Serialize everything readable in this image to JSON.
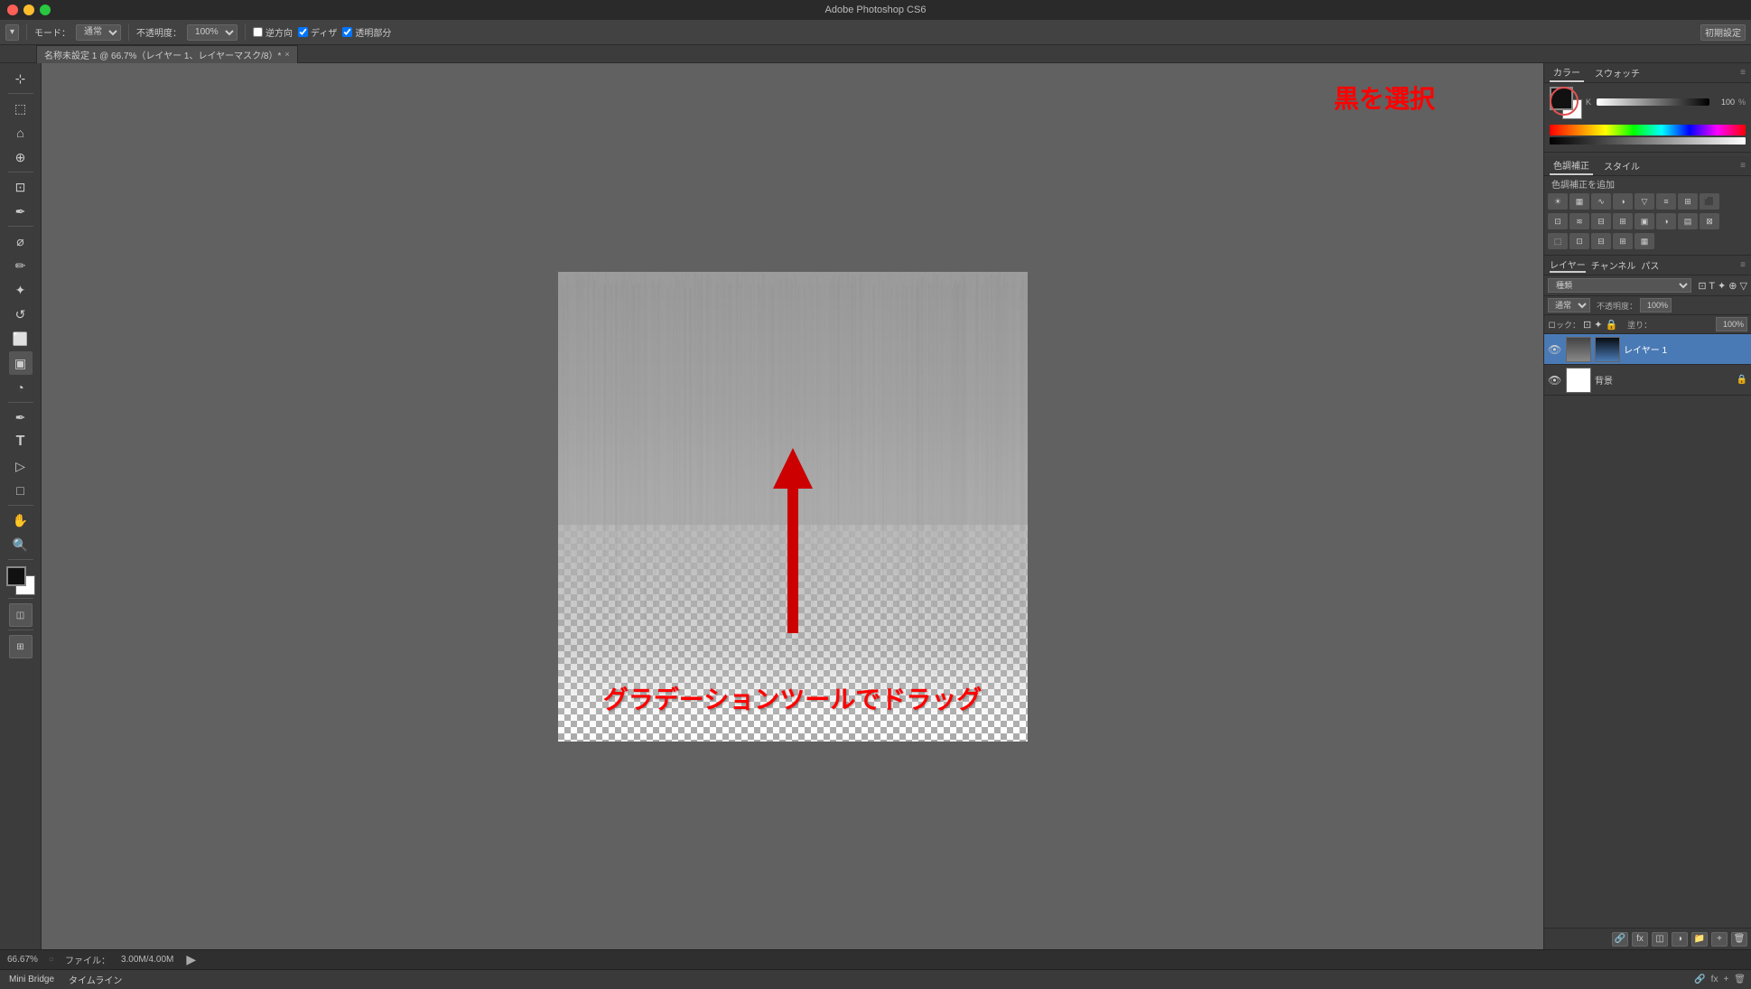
{
  "titlebar": {
    "title": "Adobe Photoshop CS6"
  },
  "options_bar": {
    "tool_preset": "▾",
    "mode_label": "モード：",
    "mode_value": "通常",
    "opacity_label": "不透明度：",
    "opacity_value": "100%",
    "reverse_label": "逆方向",
    "dither_label": "ディザ",
    "transparency_label": "透明部分"
  },
  "doc_tab": {
    "name": "名称未設定 1 @ 66.7%（レイヤー 1、レイヤーマスク/8）*",
    "close": "×"
  },
  "top_right": {
    "preset": "初期設定"
  },
  "canvas": {
    "annotation_text": "黒を選択",
    "drag_text": "グラデーションツールでドラッグ"
  },
  "color_panel": {
    "header_tab1": "カラー",
    "header_tab2": "スウォッチ",
    "slider_k_label": "K",
    "slider_k_value": "100",
    "percent": "%"
  },
  "adjustments_panel": {
    "header_tab1": "色調補正",
    "header_tab2": "スタイル",
    "add_label": "色調補正を追加"
  },
  "layers_panel": {
    "header_tab1": "レイヤー",
    "header_tab2": "チャンネル",
    "header_tab3": "パス",
    "search_placeholder": "種類",
    "mode_value": "通常",
    "opacity_label": "不透明度：",
    "opacity_value": "100%",
    "lock_label": "ロック：",
    "fill_label": "塗り：",
    "fill_value": "100%",
    "layer1_name": "レイヤー 1",
    "layer2_name": "背景"
  },
  "status_bar": {
    "zoom": "66.67%",
    "file_label": "ファイル：",
    "file_value": "3.00M/4.00M"
  },
  "bottom_panels": {
    "tab1": "Mini Bridge",
    "tab2": "タイムライン"
  }
}
